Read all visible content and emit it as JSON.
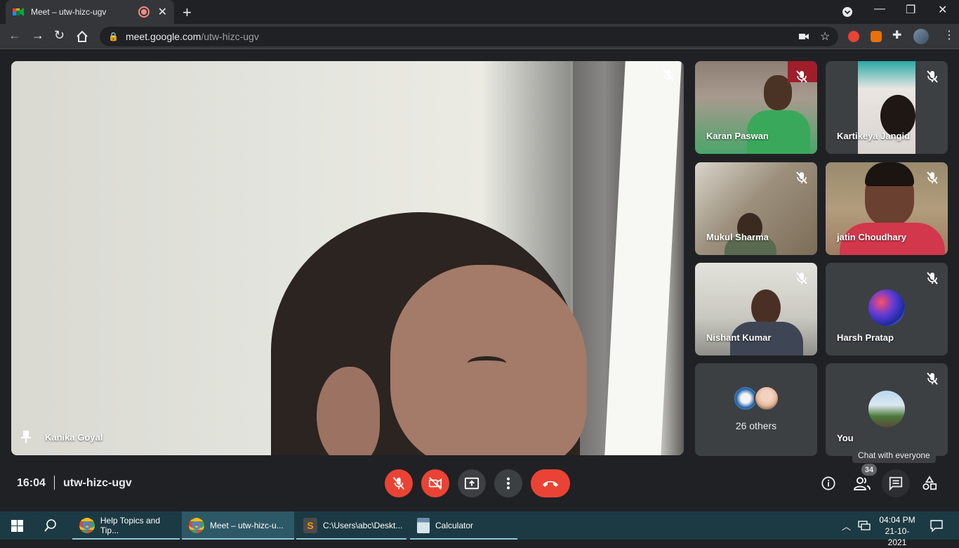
{
  "browser": {
    "tab_title": "Meet – utw-hizc-ugv",
    "url_host": "meet.google.com",
    "url_path": "/utw-hizc-ugv"
  },
  "meeting": {
    "main_speaker": "Kanika Goyal",
    "time": "16:04",
    "code": "utw-hizc-ugv",
    "participants": [
      {
        "name": "Karan Paswan"
      },
      {
        "name": "Kartikeya Jangid"
      },
      {
        "name": "Mukul Sharma"
      },
      {
        "name": "jatin Choudhary"
      },
      {
        "name": "Nishant Kumar"
      },
      {
        "name": "Harsh Pratap"
      }
    ],
    "others_label": "26 others",
    "you_label": "You",
    "participant_count": "34",
    "tooltip": "Chat with everyone"
  },
  "taskbar": {
    "items": [
      {
        "label": "Help Topics and Tip..."
      },
      {
        "label": "Meet – utw-hizc-u..."
      },
      {
        "label": "C:\\Users\\abc\\Deskt..."
      },
      {
        "label": "Calculator"
      }
    ],
    "time": "04:04 PM",
    "date": "21-10-2021"
  },
  "colors": {
    "accent_red": "#ea4335",
    "surface": "#202124",
    "tile": "#3c4043",
    "taskbar": "#1c3a44"
  }
}
